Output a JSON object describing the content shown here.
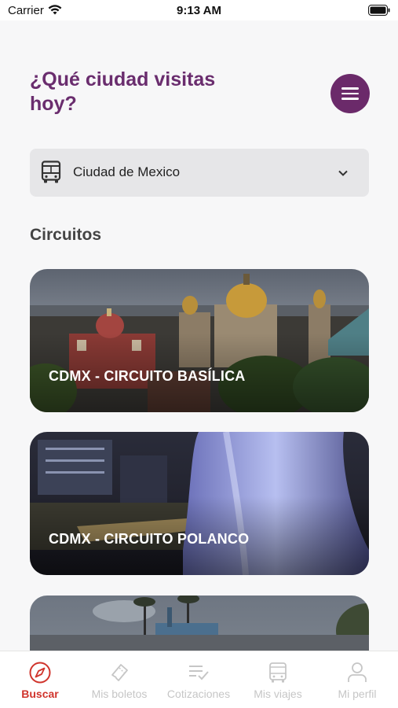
{
  "status_bar": {
    "carrier": "Carrier",
    "time": "9:13 AM"
  },
  "header": {
    "title": "¿Qué ciudad visitas hoy?"
  },
  "city_select": {
    "selected": "Ciudad de Mexico"
  },
  "section": {
    "title": "Circuitos"
  },
  "circuits": [
    {
      "label": "CDMX - CIRCUITO BASÍLICA"
    },
    {
      "label": "CDMX - CIRCUITO POLANCO"
    },
    {
      "label": ""
    }
  ],
  "tabs": [
    {
      "label": "Buscar",
      "icon": "compass-icon",
      "active": true
    },
    {
      "label": "Mis boletos",
      "icon": "ticket-icon",
      "active": false
    },
    {
      "label": "Cotizaciones",
      "icon": "checklist-icon",
      "active": false
    },
    {
      "label": "Mis viajes",
      "icon": "bus-icon",
      "active": false
    },
    {
      "label": "Mi perfil",
      "icon": "person-icon",
      "active": false
    }
  ],
  "colors": {
    "brand": "#6b2a6a",
    "active_tab": "#d0342c",
    "inactive_tab": "#c6c6c6"
  }
}
